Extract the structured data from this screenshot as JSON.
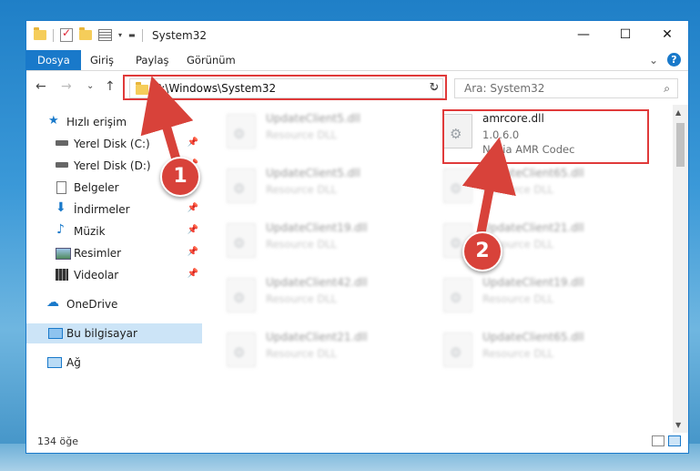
{
  "window": {
    "title": "System32",
    "controls": [
      "—",
      "☐",
      "✕"
    ]
  },
  "ribbon": {
    "tabs": [
      "Dosya",
      "Giriş",
      "Paylaş",
      "Görünüm"
    ],
    "expand": "⌄",
    "help": "?"
  },
  "nav": {
    "back": "←",
    "forward": "→",
    "recent": "⌄",
    "up": "↑",
    "address": "C:\\Windows\\System32",
    "address_dropdown": "⌄",
    "refresh": "↻",
    "search_placeholder": "Ara: System32",
    "search_icon": "⌕"
  },
  "sidebar": {
    "items": [
      {
        "label": "Hızlı erişim",
        "icon": "star-icon",
        "pinned": false
      },
      {
        "label": "Yerel Disk (C:)",
        "icon": "drive-icon",
        "pinned": true
      },
      {
        "label": "Yerel Disk (D:)",
        "icon": "drive-icon",
        "pinned": true
      },
      {
        "label": "Belgeler",
        "icon": "documents-icon",
        "pinned": true
      },
      {
        "label": "İndirmeler",
        "icon": "download-icon",
        "pinned": true
      },
      {
        "label": "Müzik",
        "icon": "music-icon",
        "pinned": true
      },
      {
        "label": "Resimler",
        "icon": "pictures-icon",
        "pinned": true
      },
      {
        "label": "Videolar",
        "icon": "videos-icon",
        "pinned": true
      },
      {
        "label": "OneDrive",
        "icon": "cloud-icon",
        "pinned": false
      },
      {
        "label": "Bu bilgisayar",
        "icon": "computer-icon",
        "pinned": false
      },
      {
        "label": "Ağ",
        "icon": "network-icon",
        "pinned": false
      }
    ],
    "pin_glyph": "📌"
  },
  "files": {
    "left": [
      {
        "name": "UpdateClient5.dll",
        "type": "Resource DLL"
      },
      {
        "name": "UpdateClient5.dll",
        "type": "Resource DLL"
      },
      {
        "name": "UpdateClient19.dll",
        "type": "Resource DLL"
      },
      {
        "name": "UpdateClient42.dll",
        "type": "Resource DLL"
      },
      {
        "name": "UpdateClient21.dll",
        "type": "Resource DLL"
      }
    ],
    "highlight": {
      "name": "amrcore.dll",
      "version": "1.0.6.0",
      "description": "Nokia AMR Codec"
    },
    "right": [
      {
        "name": "UpdateClient65.dll",
        "type": "Resource DLL"
      },
      {
        "name": "UpdateClient21.dll",
        "type": "Resource DLL"
      },
      {
        "name": "UpdateClient19.dll",
        "type": "Resource DLL"
      },
      {
        "name": "UpdateClient65.dll",
        "type": "Resource DLL"
      }
    ]
  },
  "status": {
    "count": "134 öğe"
  },
  "markers": {
    "one": "1",
    "two": "2"
  },
  "colors": {
    "accent": "#1979ca",
    "annotation": "#e03a3a"
  }
}
